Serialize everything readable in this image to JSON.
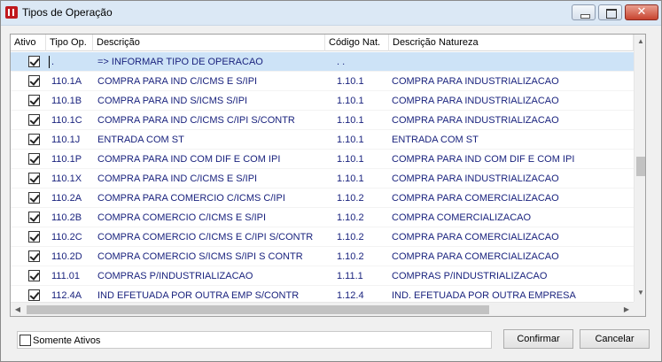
{
  "window": {
    "title": "Tipos de Operação"
  },
  "titlebar_buttons": {
    "minimize": "minimize-icon",
    "maximize": "maximize-icon",
    "close": "close-icon",
    "close_glyph": "✕"
  },
  "grid": {
    "columns": [
      "Ativo",
      "Tipo Op.",
      "Descrição",
      "Código Nat.",
      "Descrição Natureza"
    ],
    "rows": [
      {
        "active": true,
        "tipo": ".",
        "descricao": "=> INFORMAR TIPO DE OPERACAO",
        "codigo": ". .",
        "natureza": "",
        "selected": true
      },
      {
        "active": true,
        "tipo": "110.1A",
        "descricao": "COMPRA PARA IND C/ICMS E S/IPI",
        "codigo": "1.10.1",
        "natureza": "COMPRA PARA INDUSTRIALIZACAO"
      },
      {
        "active": true,
        "tipo": "110.1B",
        "descricao": "COMPRA PARA IND S/ICMS S/IPI",
        "codigo": "1.10.1",
        "natureza": "COMPRA PARA INDUSTRIALIZACAO"
      },
      {
        "active": true,
        "tipo": "110.1C",
        "descricao": "COMPRA PARA IND C/ICMS C/IPI S/CONTR",
        "codigo": "1.10.1",
        "natureza": "COMPRA PARA INDUSTRIALIZACAO"
      },
      {
        "active": true,
        "tipo": "110.1J",
        "descricao": "ENTRADA COM ST",
        "codigo": "1.10.1",
        "natureza": "ENTRADA COM ST"
      },
      {
        "active": true,
        "tipo": "110.1P",
        "descricao": "COMPRA PARA IND COM DIF E COM IPI",
        "codigo": "1.10.1",
        "natureza": "COMPRA PARA IND COM DIF E COM IPI"
      },
      {
        "active": true,
        "tipo": "110.1X",
        "descricao": "COMPRA PARA IND C/ICMS E S/IPI",
        "codigo": "1.10.1",
        "natureza": "COMPRA PARA INDUSTRIALIZACAO"
      },
      {
        "active": true,
        "tipo": "110.2A",
        "descricao": "COMPRA PARA COMERCIO C/ICMS C/IPI",
        "codigo": "1.10.2",
        "natureza": "COMPRA PARA COMERCIALIZACAO"
      },
      {
        "active": true,
        "tipo": "110.2B",
        "descricao": "COMPRA COMERCIO  C/ICMS E S/IPI",
        "codigo": "1.10.2",
        "natureza": "COMPRA COMERCIALIZACAO"
      },
      {
        "active": true,
        "tipo": "110.2C",
        "descricao": "COMPRA COMERCIO C/ICMS E C/IPI S/CONTR",
        "codigo": "1.10.2",
        "natureza": "COMPRA PARA COMERCIALIZACAO"
      },
      {
        "active": true,
        "tipo": "110.2D",
        "descricao": "COMPRA COMERCIO S/ICMS S/IPI  S CONTR",
        "codigo": "1.10.2",
        "natureza": "COMPRA PARA COMERCIALIZACAO"
      },
      {
        "active": true,
        "tipo": "111.01",
        "descricao": "COMPRAS P/INDUSTRIALIZACAO",
        "codigo": "1.11.1",
        "natureza": "COMPRAS P/INDUSTRIALIZACAO"
      },
      {
        "active": true,
        "tipo": "112.4A",
        "descricao": "IND EFETUADA POR OUTRA EMP S/CONTR",
        "codigo": "1.12.4",
        "natureza": "IND. EFETUADA POR OUTRA EMPRESA"
      }
    ]
  },
  "filter": {
    "somente_ativos_label": "Somente Ativos",
    "checked": false
  },
  "buttons": {
    "confirmar": "Confirmar",
    "cancelar": "Cancelar"
  },
  "scroll": {
    "up_icon": "▲",
    "down_icon": "▼",
    "left_icon": "◀",
    "right_icon": "▶"
  }
}
